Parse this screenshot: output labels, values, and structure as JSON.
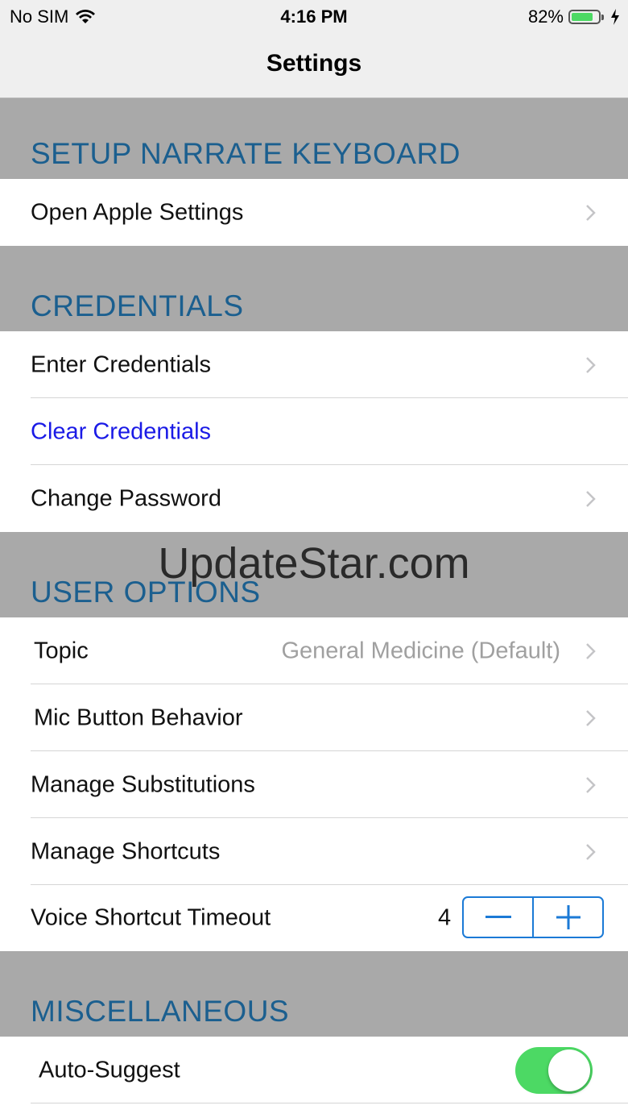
{
  "status_bar": {
    "carrier": "No SIM",
    "time": "4:16 PM",
    "battery_percent": "82%",
    "battery_level": 0.82
  },
  "nav": {
    "title": "Settings"
  },
  "sections": {
    "setup": {
      "title": "SETUP NARRATE KEYBOARD",
      "open_settings": "Open Apple Settings"
    },
    "credentials": {
      "title": "CREDENTIALS",
      "enter": "Enter Credentials",
      "clear": "Clear Credentials",
      "change_password": "Change Password"
    },
    "user_options": {
      "title": "USER OPTIONS",
      "topic": "Topic",
      "topic_value": "General Medicine (Default)",
      "mic_behavior": "Mic Button Behavior",
      "substitutions": "Manage Substitutions",
      "shortcuts": "Manage Shortcuts",
      "voice_timeout": "Voice Shortcut Timeout",
      "voice_timeout_value": "4"
    },
    "misc": {
      "title": "MISCELLANEOUS",
      "auto_suggest": "Auto-Suggest",
      "auto_suggest_on": true
    }
  },
  "watermark": "UpdateStar.com",
  "colors": {
    "section_bg": "#a9a9a9",
    "section_text": "#1b5f8f",
    "link": "#1a1ae6",
    "accent": "#1b7ad6",
    "toggle_on": "#4cd964"
  }
}
